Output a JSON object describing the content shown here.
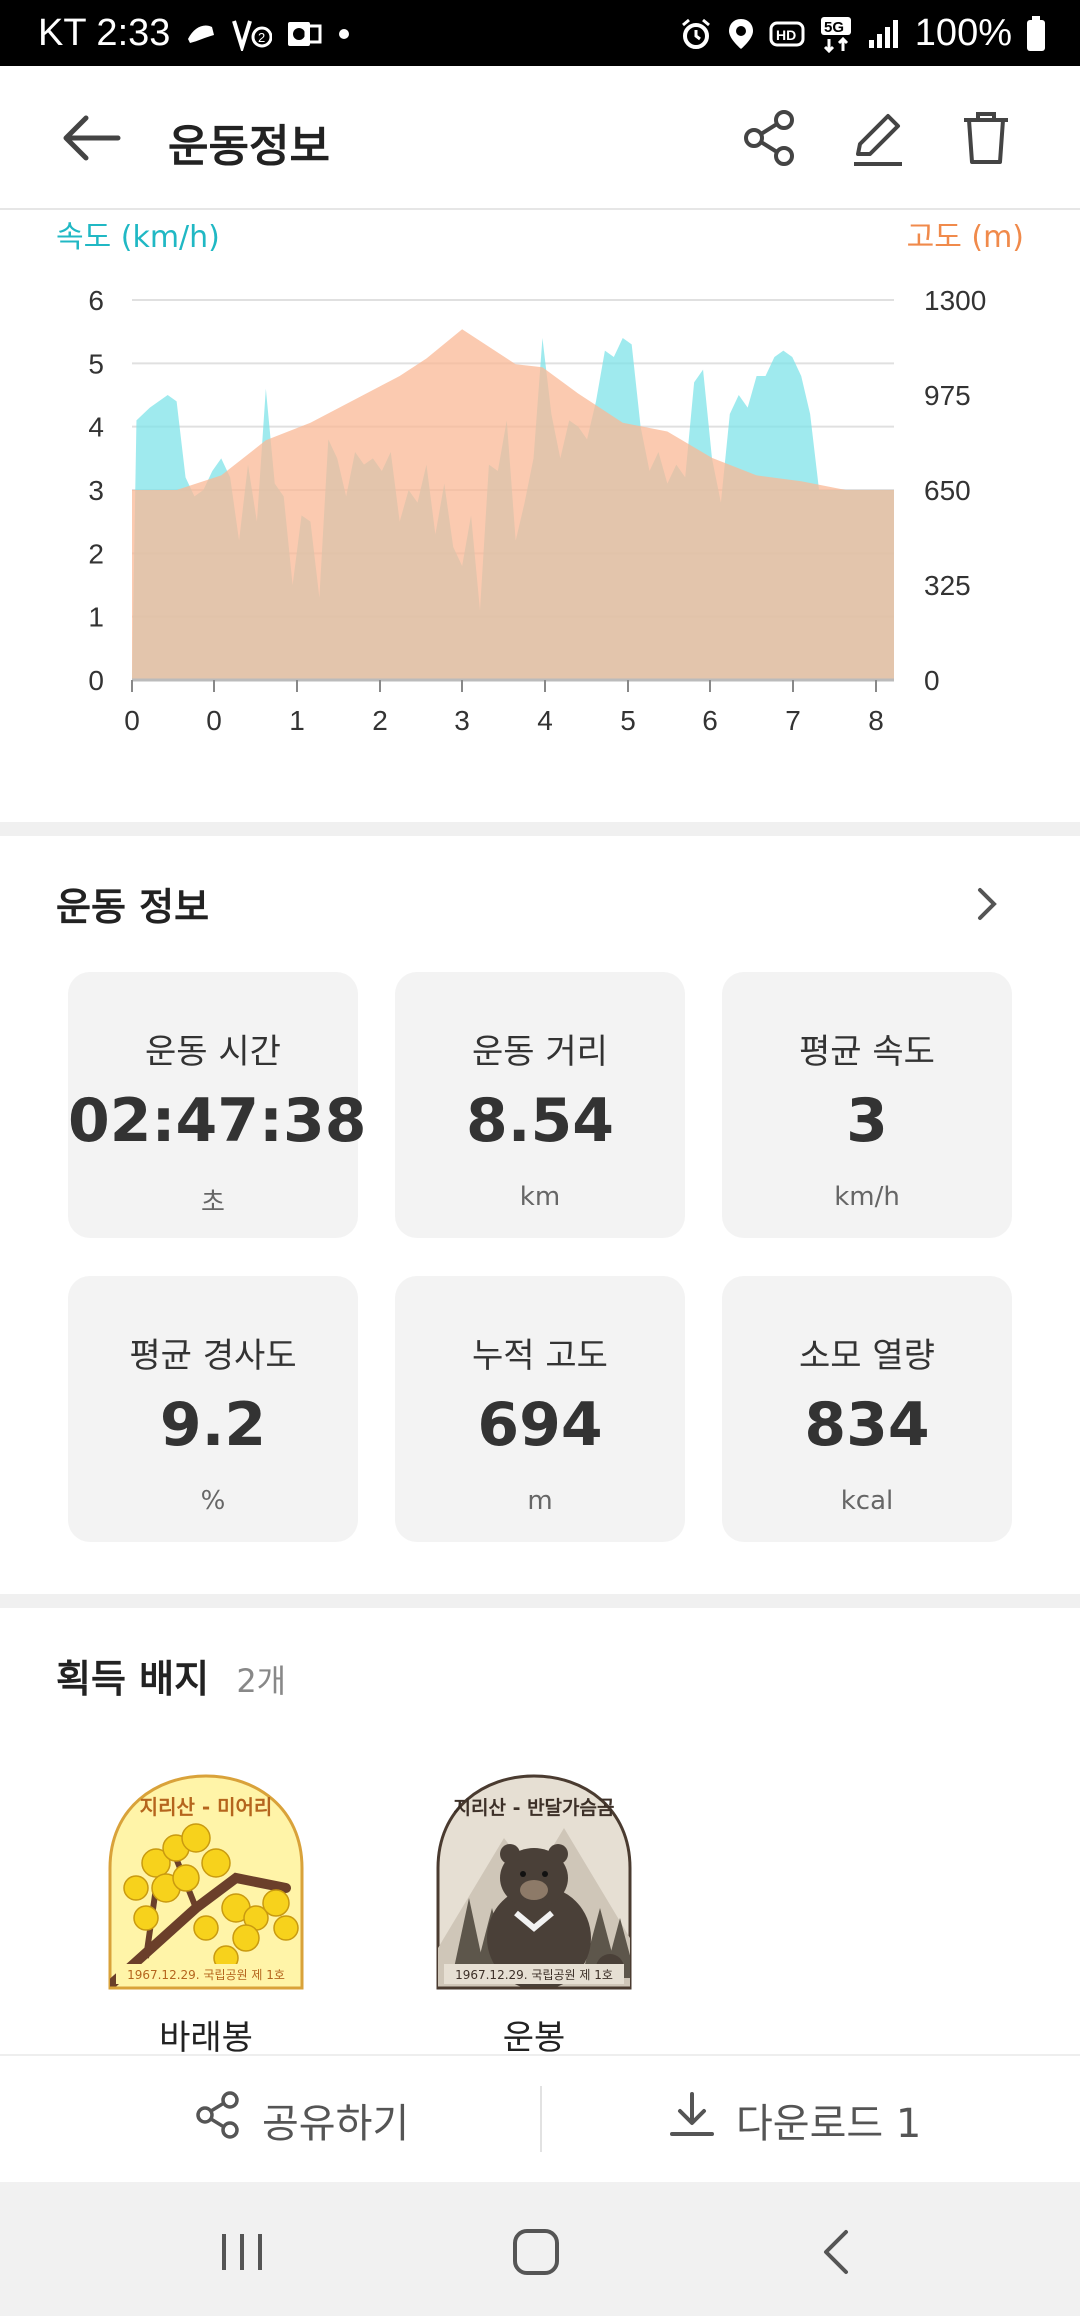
{
  "status_bar": {
    "carrier_time": "KT 2:33",
    "battery": "100%",
    "left_icons": [
      "shoe-icon",
      "v2-icon",
      "outlook-icon",
      "dot-icon"
    ],
    "right_icons": [
      "alarm-icon",
      "location-icon",
      "hd-icon",
      "5g-icon",
      "signal-icon",
      "battery-icon"
    ]
  },
  "header": {
    "title": "운동정보",
    "icons": [
      "back-arrow-icon",
      "share-icon",
      "edit-icon",
      "trash-icon"
    ]
  },
  "chart_data": {
    "type": "area",
    "left_axis_label": "속도 (km/h)",
    "right_axis_label": "고도 (m)",
    "left_ticks": [
      "6",
      "5",
      "4",
      "3",
      "2",
      "1",
      "0"
    ],
    "right_ticks": [
      "1300",
      "975",
      "650",
      "325",
      "0"
    ],
    "x_ticks": [
      "0",
      "0",
      "1",
      "2",
      "3",
      "4",
      "5",
      "6",
      "7",
      "8"
    ],
    "ylim_speed": [
      0,
      6
    ],
    "ylim_altitude": [
      0,
      1300
    ],
    "xlim": [
      0,
      8.54
    ],
    "speed_color": "#7fe3e8",
    "altitude_color": "#f9b896",
    "series": [
      {
        "name": "속도",
        "axis": "left",
        "x": [
          0,
          0.05,
          0.2,
          0.4,
          0.5,
          0.6,
          0.7,
          0.8,
          0.9,
          1.0,
          1.1,
          1.2,
          1.3,
          1.4,
          1.5,
          1.6,
          1.7,
          1.8,
          1.9,
          2.0,
          2.1,
          2.2,
          2.3,
          2.4,
          2.5,
          2.6,
          2.7,
          2.8,
          2.9,
          3.0,
          3.1,
          3.2,
          3.3,
          3.4,
          3.5,
          3.6,
          3.7,
          3.8,
          3.9,
          4.0,
          4.1,
          4.2,
          4.3,
          4.4,
          4.5,
          4.6,
          4.7,
          4.8,
          4.9,
          5.0,
          5.1,
          5.2,
          5.3,
          5.4,
          5.5,
          5.6,
          5.7,
          5.8,
          5.9,
          6.0,
          6.1,
          6.2,
          6.3,
          6.4,
          6.5,
          6.6,
          6.7,
          6.8,
          6.9,
          7.0,
          7.1,
          7.2,
          7.3,
          7.4,
          7.5,
          7.6,
          7.7,
          7.8,
          7.9,
          8.0,
          8.1,
          8.2,
          8.3,
          8.54
        ],
        "values": [
          0,
          4.1,
          4.3,
          4.5,
          4.4,
          3.2,
          2.9,
          3.0,
          3.3,
          3.5,
          3.2,
          2.2,
          3.4,
          2.5,
          4.6,
          3.1,
          2.9,
          1.5,
          2.6,
          2.5,
          1.3,
          3.8,
          3.5,
          2.9,
          3.6,
          3.4,
          3.5,
          3.3,
          3.6,
          2.5,
          3.0,
          2.8,
          3.4,
          2.3,
          3.1,
          2.1,
          1.8,
          2.6,
          1.1,
          3.4,
          3.3,
          4.1,
          2.2,
          2.8,
          3.5,
          5.4,
          4.2,
          3.5,
          4.1,
          4.0,
          3.8,
          4.4,
          5.2,
          5.1,
          5.4,
          5.3,
          4.0,
          3.3,
          3.6,
          3.1,
          3.4,
          3.2,
          4.7,
          4.9,
          3.5,
          2.8,
          4.2,
          4.5,
          4.3,
          4.8,
          4.8,
          5.1,
          5.2,
          5.1,
          4.8,
          4.2,
          3.0,
          3.0,
          3.0,
          3.0,
          3.0,
          3.0,
          3.0,
          3.0
        ]
      },
      {
        "name": "고도",
        "axis": "right",
        "x": [
          0,
          0.5,
          1.0,
          1.5,
          2.0,
          2.5,
          3.0,
          3.3,
          3.5,
          3.7,
          4.0,
          4.3,
          4.6,
          5.0,
          5.5,
          6.0,
          6.5,
          7.0,
          7.5,
          8.0,
          8.54
        ],
        "values": [
          650,
          650,
          700,
          820,
          880,
          960,
          1040,
          1100,
          1150,
          1200,
          1140,
          1080,
          1070,
          980,
          880,
          850,
          760,
          700,
          680,
          650,
          650
        ]
      }
    ]
  },
  "workout_info": {
    "section_title": "운동 정보",
    "more_icon": "chevron-right-icon",
    "stats": [
      {
        "key": "time",
        "label": "운동 시간",
        "value": "02:47:38",
        "unit": "초"
      },
      {
        "key": "distance",
        "label": "운동 거리",
        "value": "8.54",
        "unit": "km"
      },
      {
        "key": "avg_speed",
        "label": "평균 속도",
        "value": "3",
        "unit": "km/h"
      },
      {
        "key": "avg_slope",
        "label": "평균 경사도",
        "value": "9.2",
        "unit": "%"
      },
      {
        "key": "elevation_gain",
        "label": "누적 고도",
        "value": "694",
        "unit": "m"
      },
      {
        "key": "calories",
        "label": "소모 열량",
        "value": "834",
        "unit": "kcal"
      }
    ]
  },
  "badges": {
    "section_title": "획득 배지",
    "count": "2개",
    "items": [
      {
        "name": "바래봉",
        "badge_title": "지리산 - 미어리",
        "badge_sub": "1967.12.29. 국립공원 제 1호"
      },
      {
        "name": "운봉",
        "badge_title": "지리산 - 반달가슴곰",
        "badge_sub": "1967.12.29. 국립공원 제 1호"
      }
    ]
  },
  "actions": {
    "share_label": "공유하기",
    "download_label": "다운로드 1"
  },
  "colors": {
    "speed": "#7fe3e8",
    "altitude": "#f9b896",
    "speed_axis_label": "#20b8c4",
    "altitude_axis_label": "#f08a4b"
  }
}
